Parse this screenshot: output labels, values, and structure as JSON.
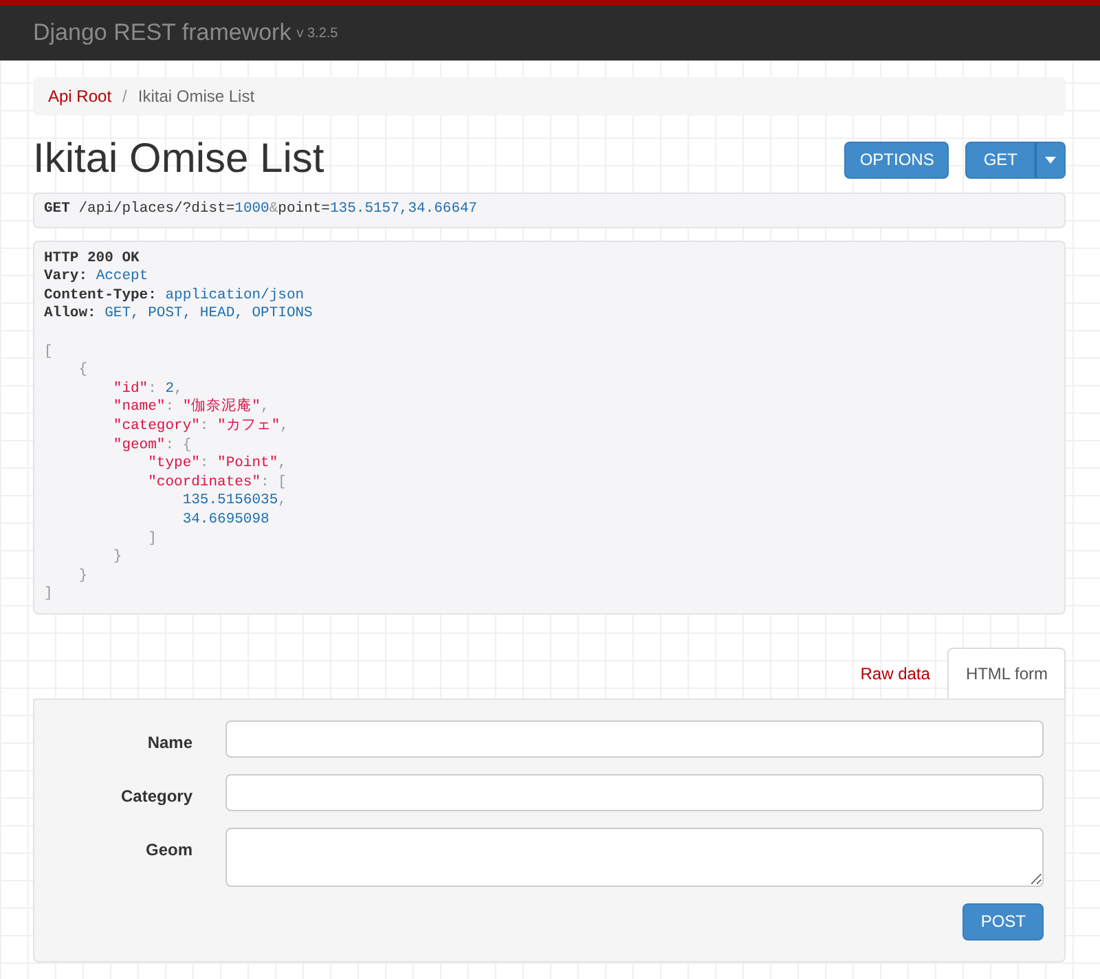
{
  "navbar": {
    "brand": "Django REST framework",
    "version": "v 3.2.5"
  },
  "breadcrumb": {
    "separator": "/",
    "items": [
      {
        "label": "Api Root",
        "active": false
      },
      {
        "label": "Ikitai Omise List",
        "active": true
      }
    ]
  },
  "title": "Ikitai Omise List",
  "buttons": [
    {
      "label": "OPTIONS",
      "kind": "plain"
    },
    {
      "label": "GET",
      "kind": "split"
    }
  ],
  "request": {
    "method": "GET",
    "parts": [
      {
        "kind": "plain",
        "t": "/api/places/?dist="
      },
      {
        "kind": "num",
        "t": "1000"
      },
      {
        "kind": "punct",
        "t": "&"
      },
      {
        "kind": "plain",
        "t": "point="
      },
      {
        "kind": "num",
        "t": "135.5157,34.66647"
      }
    ]
  },
  "response": {
    "status": "HTTP 200 OK",
    "headers": [
      {
        "name": "Vary:",
        "value": "Accept"
      },
      {
        "name": "Content-Type:",
        "value": "application/json"
      },
      {
        "name": "Allow:",
        "value": "GET, POST, HEAD, OPTIONS"
      }
    ],
    "body": [
      [
        {
          "kind": "punct",
          "t": "["
        }
      ],
      [
        {
          "kind": "punct",
          "t": "    {"
        }
      ],
      [
        {
          "kind": "key",
          "t": "        \"id\""
        },
        {
          "kind": "punct",
          "t": ": "
        },
        {
          "kind": "num",
          "t": "2"
        },
        {
          "kind": "punct",
          "t": ","
        }
      ],
      [
        {
          "kind": "key",
          "t": "        \"name\""
        },
        {
          "kind": "punct",
          "t": ": "
        },
        {
          "kind": "str",
          "t": "\"伽奈泥庵\""
        },
        {
          "kind": "punct",
          "t": ","
        }
      ],
      [
        {
          "kind": "key",
          "t": "        \"category\""
        },
        {
          "kind": "punct",
          "t": ": "
        },
        {
          "kind": "str",
          "t": "\"カフェ\""
        },
        {
          "kind": "punct",
          "t": ","
        }
      ],
      [
        {
          "kind": "key",
          "t": "        \"geom\""
        },
        {
          "kind": "punct",
          "t": ": {"
        }
      ],
      [
        {
          "kind": "key",
          "t": "            \"type\""
        },
        {
          "kind": "punct",
          "t": ": "
        },
        {
          "kind": "str",
          "t": "\"Point\""
        },
        {
          "kind": "punct",
          "t": ","
        }
      ],
      [
        {
          "kind": "key",
          "t": "            \"coordinates\""
        },
        {
          "kind": "punct",
          "t": ": ["
        }
      ],
      [
        {
          "kind": "num",
          "t": "                135.5156035"
        },
        {
          "kind": "punct",
          "t": ","
        }
      ],
      [
        {
          "kind": "num",
          "t": "                34.6695098"
        }
      ],
      [
        {
          "kind": "punct",
          "t": "            ]"
        }
      ],
      [
        {
          "kind": "punct",
          "t": "        }"
        }
      ],
      [
        {
          "kind": "punct",
          "t": "    }"
        }
      ],
      [
        {
          "kind": "punct",
          "t": "]"
        }
      ]
    ]
  },
  "tabs": [
    {
      "label": "Raw data",
      "selected": false
    },
    {
      "label": "HTML form",
      "selected": true
    }
  ],
  "form": {
    "fields": [
      {
        "label": "Name",
        "kind": "input"
      },
      {
        "label": "Category",
        "kind": "input"
      },
      {
        "label": "Geom",
        "kind": "textarea"
      }
    ],
    "submit": "POST"
  }
}
